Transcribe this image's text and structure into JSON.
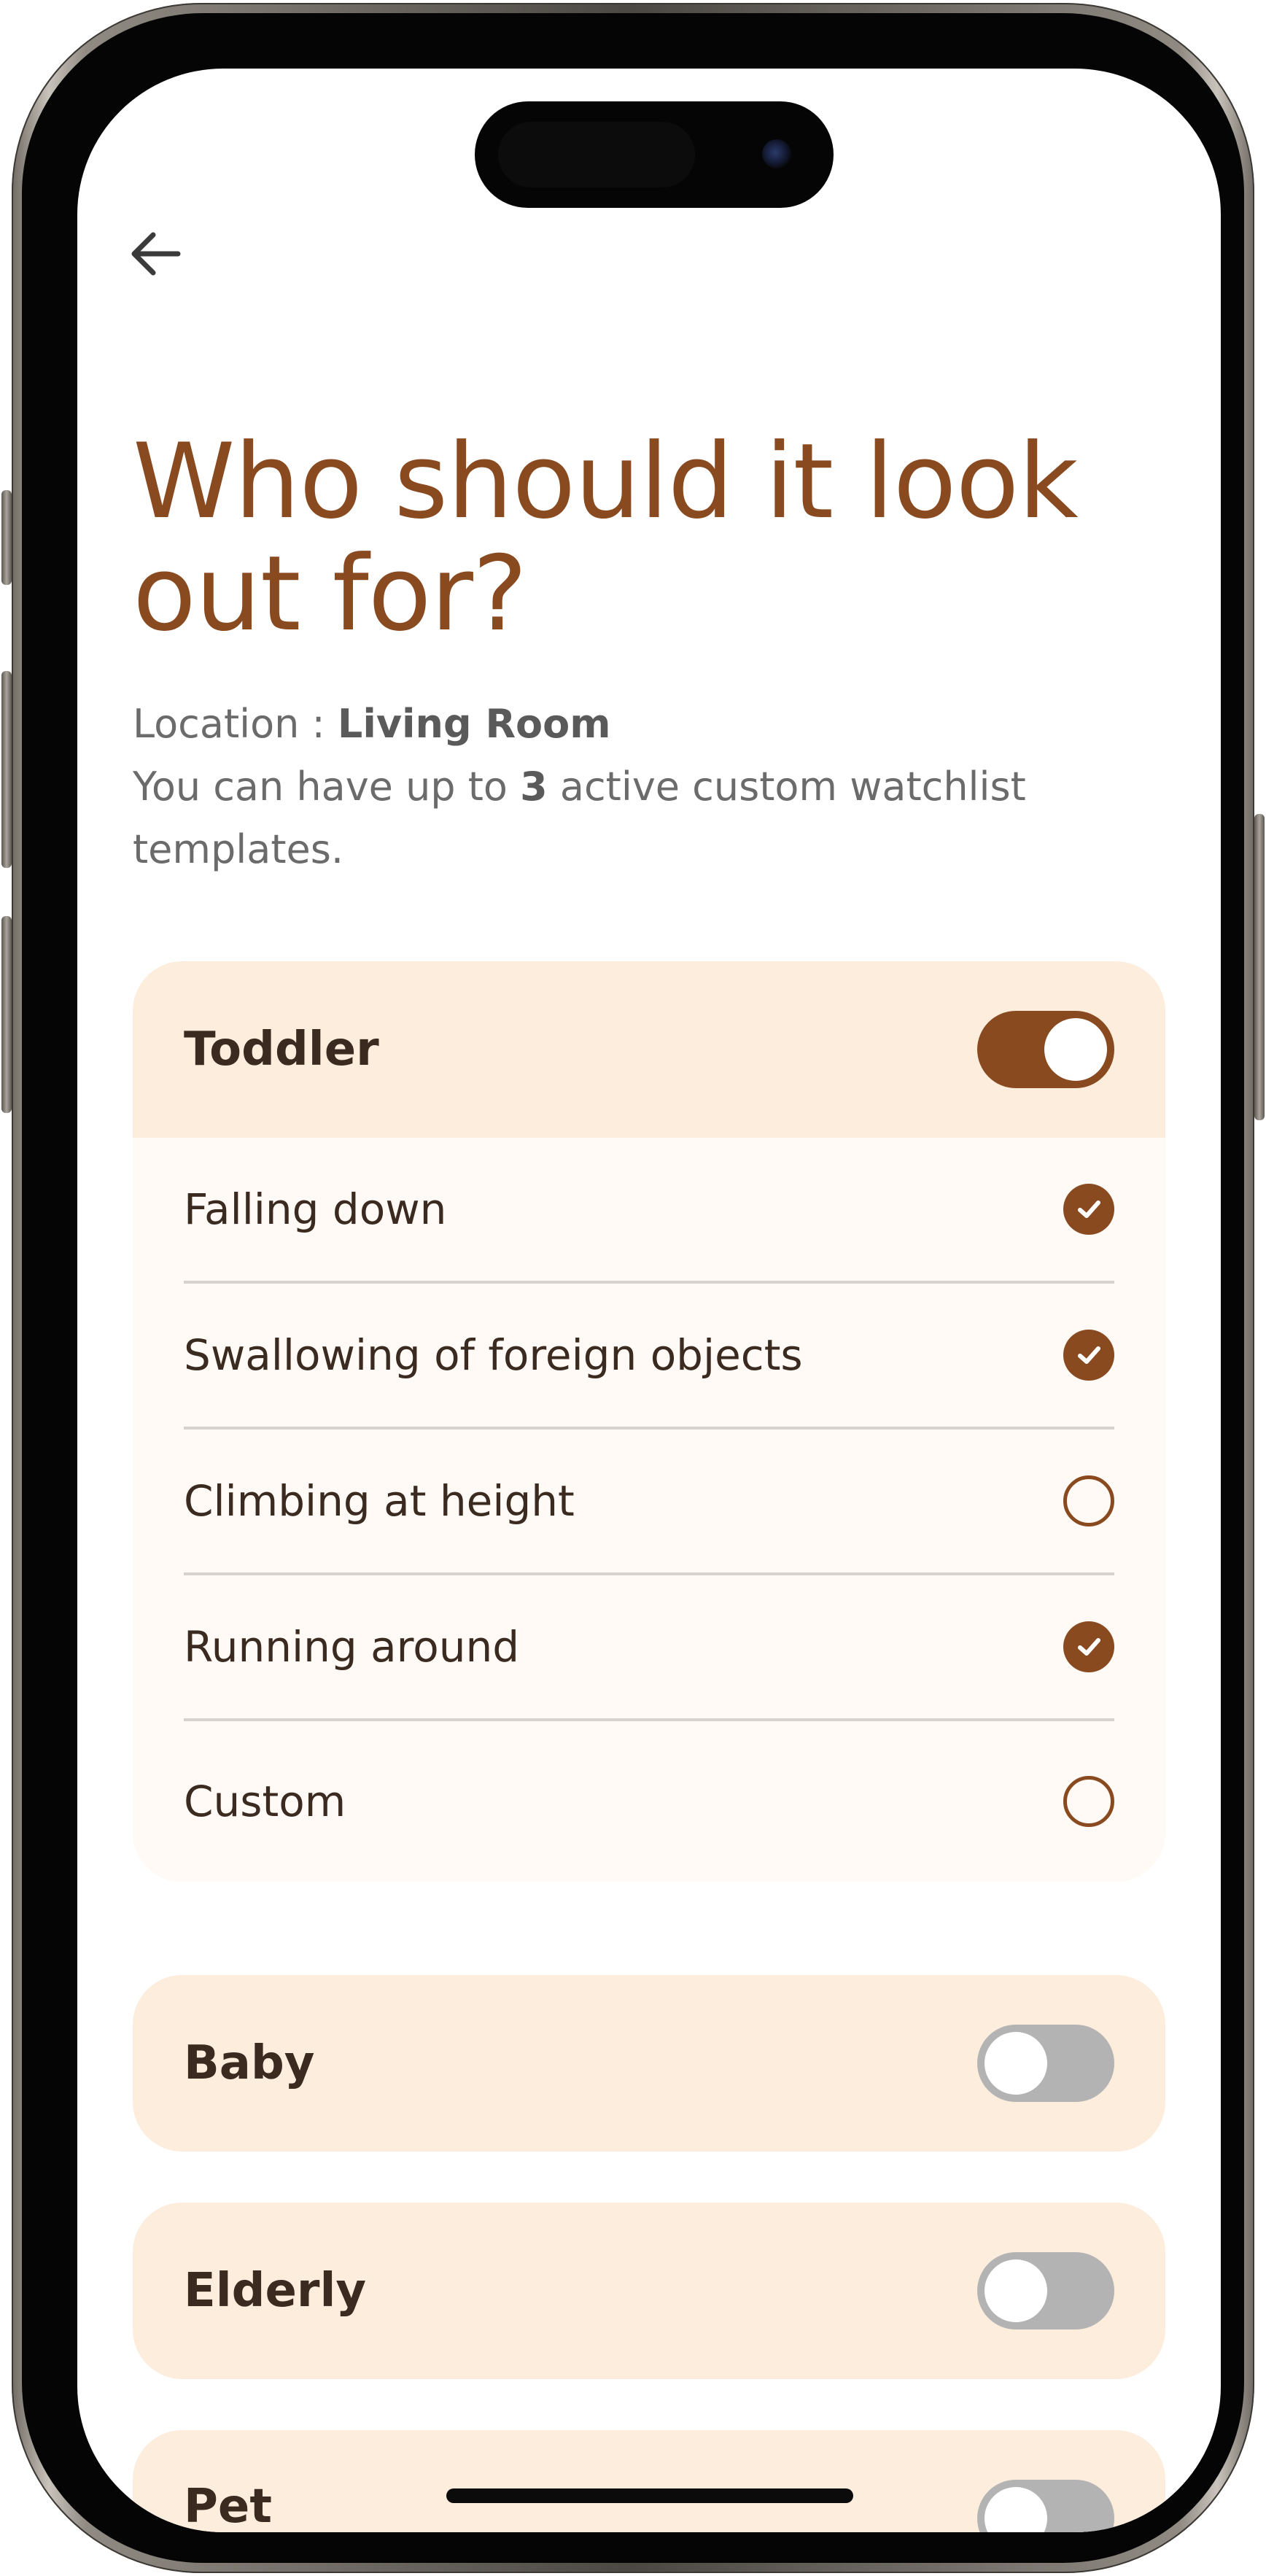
{
  "header": {
    "title_line1": "Who should it look",
    "title_line2": "out for?"
  },
  "info": {
    "location_prefix": "Location : ",
    "location_value": "Living Room",
    "limit_prefix": "You can have up to ",
    "limit_value": "3",
    "limit_suffix": " active custom watchlist templates."
  },
  "cards": [
    {
      "title": "Toddler",
      "enabled": true,
      "items": [
        {
          "label": "Falling down",
          "checked": true
        },
        {
          "label": "Swallowing of foreign objects",
          "checked": true
        },
        {
          "label": "Climbing at height",
          "checked": false
        },
        {
          "label": "Running around",
          "checked": true
        },
        {
          "label": "Custom",
          "checked": false
        }
      ]
    },
    {
      "title": "Baby",
      "enabled": false
    },
    {
      "title": "Elderly",
      "enabled": false
    },
    {
      "title": "Pet",
      "enabled": false
    }
  ],
  "colors": {
    "accent": "#8a4a20",
    "card_header": "#fdeddd",
    "card_body": "#fffaf5",
    "toggle_off": "#b3b3b3"
  },
  "icons": {
    "back": "arrow-left-icon",
    "checked": "checkmark-circle-icon",
    "unchecked": "empty-circle-icon"
  }
}
